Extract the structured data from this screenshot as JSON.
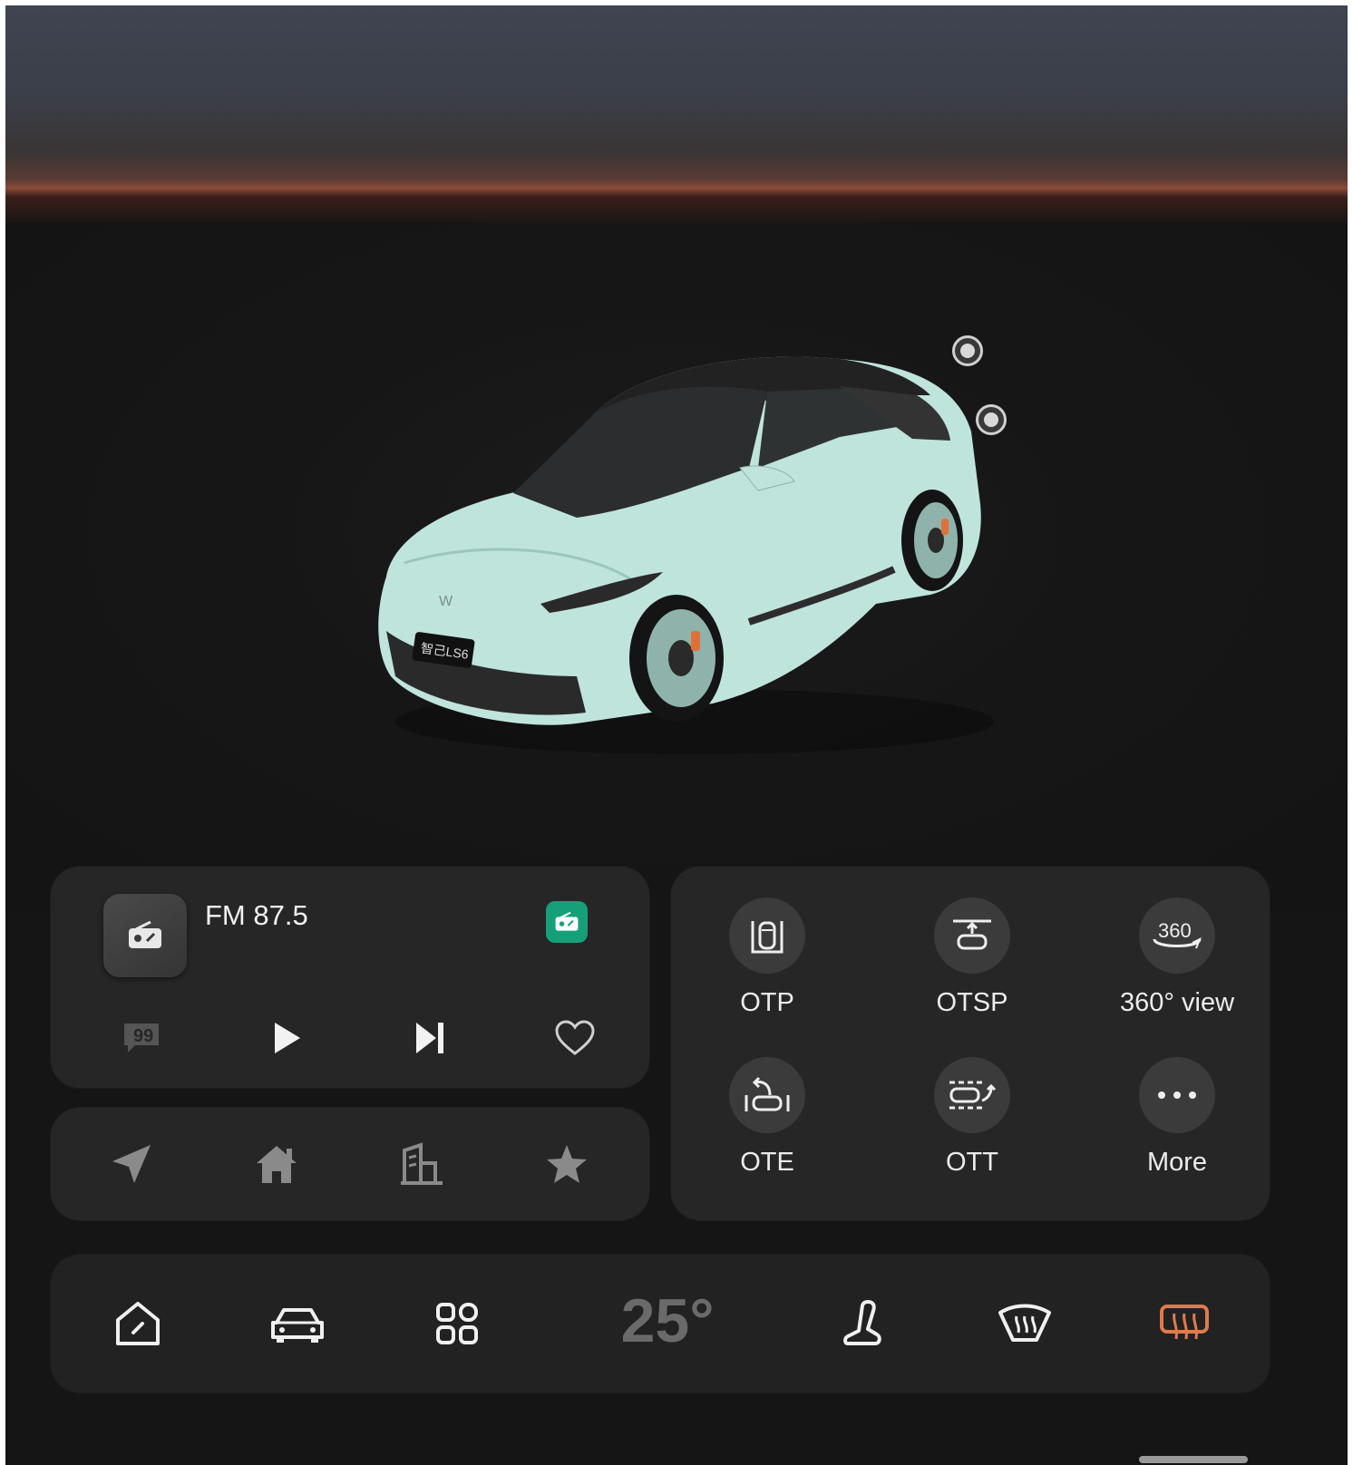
{
  "media": {
    "station": "FM 87.5",
    "source_badge_icon": "radio-icon",
    "thumbnail_icon": "radio-icon",
    "controls": [
      {
        "name": "quote-icon"
      },
      {
        "name": "play-icon"
      },
      {
        "name": "next-track-icon"
      },
      {
        "name": "heart-icon"
      }
    ]
  },
  "navigation": {
    "shortcuts": [
      "navigate-icon",
      "home-icon",
      "office-icon",
      "favorite-icon"
    ]
  },
  "quick_actions": [
    {
      "label": "OTP",
      "icon": "parking-icon"
    },
    {
      "label": "OTSP",
      "icon": "summon-parking-icon"
    },
    {
      "label": "360° view",
      "icon": "360-view-icon"
    },
    {
      "label": "OTE",
      "icon": "exit-icon"
    },
    {
      "label": "OTT",
      "icon": "trailer-icon"
    },
    {
      "label": "More",
      "icon": "more-icon"
    }
  ],
  "dock": {
    "temperature": "25°",
    "items": [
      "home-icon",
      "car-icon",
      "apps-icon",
      "seat-icon",
      "front-defrost-icon",
      "rear-defrost-icon"
    ],
    "active_color": "#e07a4c"
  },
  "vehicle": {
    "plate": "智己LS6",
    "body_color": "#bfe4dc"
  },
  "colors": {
    "accent_green": "#16a07a",
    "card_bg": "#262626"
  }
}
